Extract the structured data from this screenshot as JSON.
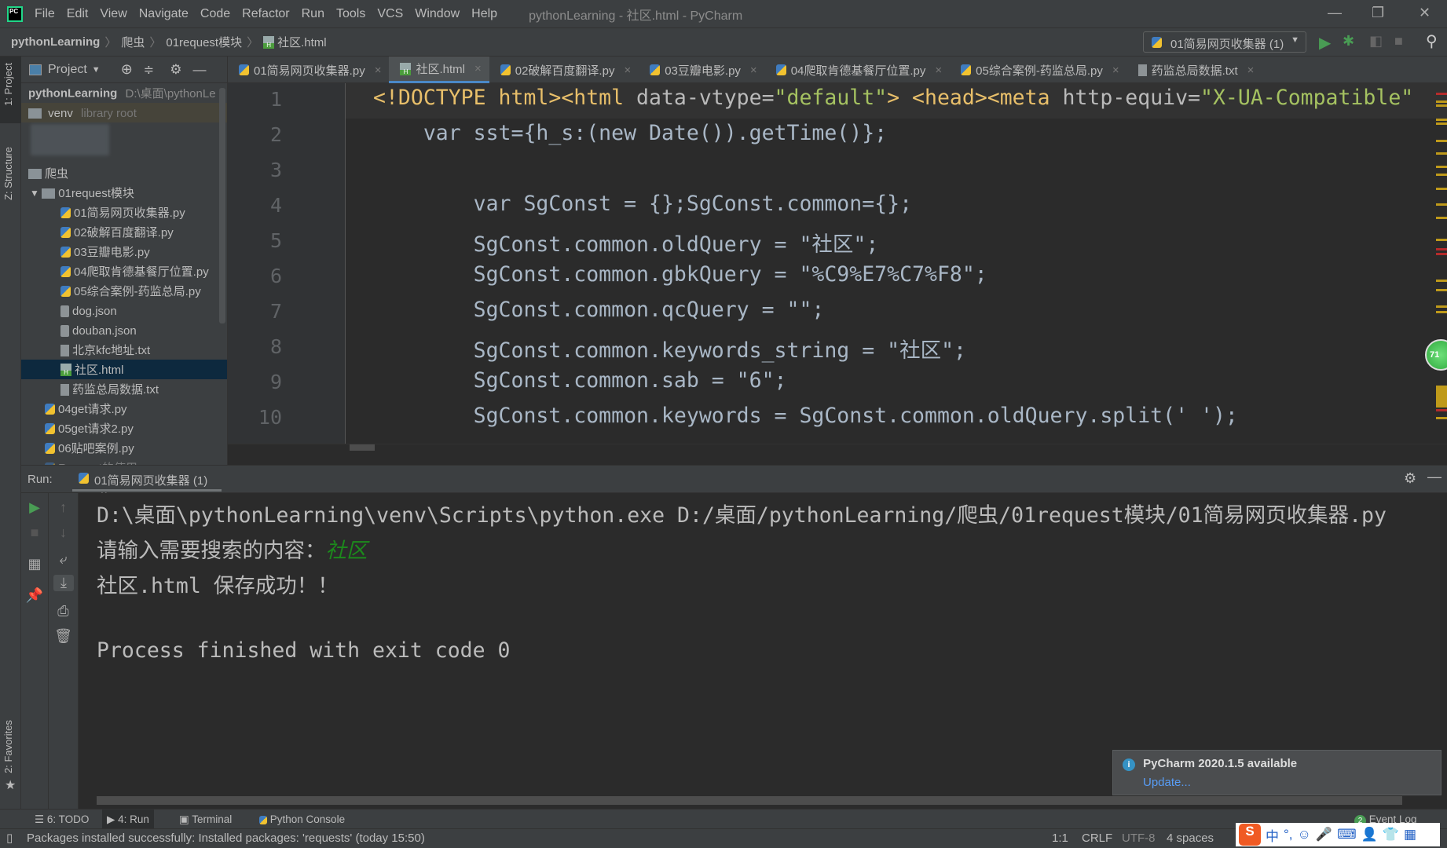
{
  "menubar": {
    "logo": "PC",
    "items": [
      "File",
      "Edit",
      "View",
      "Navigate",
      "Code",
      "Refactor",
      "Run",
      "Tools",
      "VCS",
      "Window",
      "Help"
    ],
    "title": "pythonLearning - 社区.html - PyCharm"
  },
  "navbar": {
    "breadcrumbs": [
      "pythonLearning",
      "爬虫",
      "01request模块",
      "社区.html"
    ],
    "run_config": "01简易网页收集器 (1)"
  },
  "left_strip": {
    "project": "1: Project",
    "structure": "Z: Structure",
    "favorites": "2: Favorites"
  },
  "project": {
    "header": "Project",
    "root_name": "pythonLearning",
    "root_path": "D:\\桌面\\pythonLe",
    "venv": "venv",
    "venv_note": "library root",
    "items": [
      {
        "label": "爬虫",
        "type": "folder"
      },
      {
        "label": "01request模块",
        "type": "folder"
      },
      {
        "label": "01简易网页收集器.py",
        "type": "py"
      },
      {
        "label": "02破解百度翻译.py",
        "type": "py"
      },
      {
        "label": "03豆瓣电影.py",
        "type": "py"
      },
      {
        "label": "04爬取肯德基餐厅位置.py",
        "type": "py"
      },
      {
        "label": "05综合案例-药监总局.py",
        "type": "py"
      },
      {
        "label": "dog.json",
        "type": "json"
      },
      {
        "label": "douban.json",
        "type": "json"
      },
      {
        "label": "北京kfc地址.txt",
        "type": "txt"
      },
      {
        "label": "社区.html",
        "type": "html",
        "selected": true
      },
      {
        "label": "药监总局数据.txt",
        "type": "txt"
      },
      {
        "label": "04get请求.py",
        "type": "py"
      },
      {
        "label": "05get请求2.py",
        "type": "py"
      },
      {
        "label": "06贴吧案例.py",
        "type": "py"
      },
      {
        "label": "Request的使用.py",
        "type": "py"
      }
    ]
  },
  "tabs": [
    {
      "label": "01简易网页收集器.py",
      "type": "py"
    },
    {
      "label": "社区.html",
      "type": "html",
      "active": true
    },
    {
      "label": "02破解百度翻译.py",
      "type": "py"
    },
    {
      "label": "03豆瓣电影.py",
      "type": "py"
    },
    {
      "label": "04爬取肯德基餐厅位置.py",
      "type": "py"
    },
    {
      "label": "05综合案例-药监总局.py",
      "type": "py"
    },
    {
      "label": "药监总局数据.txt",
      "type": "txt"
    }
  ],
  "editor": {
    "line_numbers": [
      "1",
      "2",
      "3",
      "4",
      "5",
      "6",
      "7",
      "8",
      "9",
      "10"
    ],
    "lines": [
      [
        [
          "tag",
          "<!DOCTYPE html><html "
        ],
        [
          "attr",
          "data-vtype="
        ],
        [
          "str",
          "\"default\""
        ],
        [
          "tag",
          "> <head><meta "
        ],
        [
          "attr",
          "http-equiv="
        ],
        [
          "str",
          "\"X-UA-Compatible\""
        ]
      ],
      [
        [
          "plain",
          "    var sst={h_s:(new Date()).getTime()};"
        ]
      ],
      [
        [
          "plain",
          ""
        ]
      ],
      [
        [
          "plain",
          "        var SgConst = {};SgConst.common={};"
        ]
      ],
      [
        [
          "plain",
          "        SgConst.common.oldQuery = \"社区\";"
        ]
      ],
      [
        [
          "plain",
          "        SgConst.common.gbkQuery = \"%C9%E7%C7%F8\";"
        ]
      ],
      [
        [
          "plain",
          "        SgConst.common.qcQuery = \"\";"
        ]
      ],
      [
        [
          "plain",
          "        SgConst.common.keywords_string = \"社区\";"
        ]
      ],
      [
        [
          "plain",
          "        SgConst.common.sab = \"6\";"
        ]
      ],
      [
        [
          "plain",
          "        SgConst.common.keywords = SgConst.common.oldQuery.split(' ');"
        ]
      ]
    ],
    "badge": "71"
  },
  "run": {
    "label": "Run:",
    "tab": "01简易网页收集器 (1)",
    "console": {
      "cmd": "D:\\桌面\\pythonLearning\\venv\\Scripts\\python.exe D:/桌面/pythonLearning/爬虫/01request模块/01简易网页收集器.py",
      "prompt": "请输入需要搜索的内容：",
      "input": "社区",
      "saved": "社区.html 保存成功！！",
      "exit": "Process finished with exit code 0"
    }
  },
  "notification": {
    "title": "PyCharm 2020.1.5 available",
    "link": "Update..."
  },
  "bottom_tabs": [
    "6: TODO",
    "4: Run",
    "Terminal",
    "Python Console"
  ],
  "event_log": {
    "count": "2",
    "label": "Event Log"
  },
  "statusbar": {
    "message": "Packages installed successfully: Installed packages: 'requests' (today 15:50)",
    "position": "1:1",
    "line_sep": "CRLF",
    "encoding": "UTF-8",
    "indent": "4 spaces"
  },
  "ime": {
    "mode": "中"
  }
}
